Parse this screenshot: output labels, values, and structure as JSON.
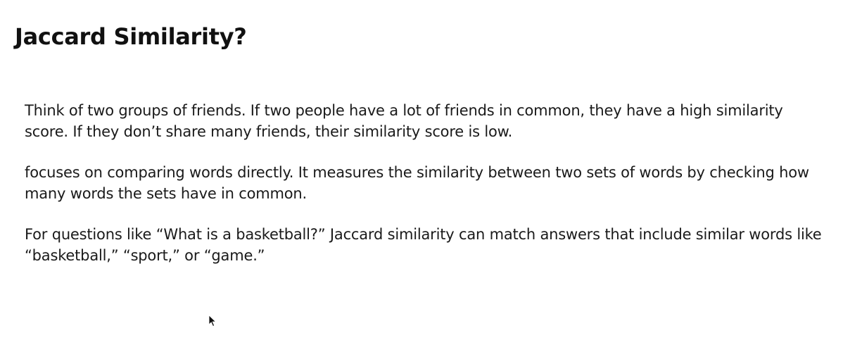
{
  "slide": {
    "title": "Jaccard Similarity?",
    "paragraphs": [
      "Think of two groups of friends. If two people have a lot of friends in common, they have a high similarity score. If they don’t share many friends, their similarity score is low.",
      "focuses on comparing words directly. It measures the similarity between two sets of words by checking how many words the sets have in common.",
      "For questions like “What is a basketball?” Jaccard similarity can match answers that include similar words like “basketball,” “sport,” or “game.”"
    ]
  },
  "cursor": {
    "icon": "mouse-pointer-icon"
  },
  "colors": {
    "background": "#ffffff",
    "text": "#111111"
  }
}
